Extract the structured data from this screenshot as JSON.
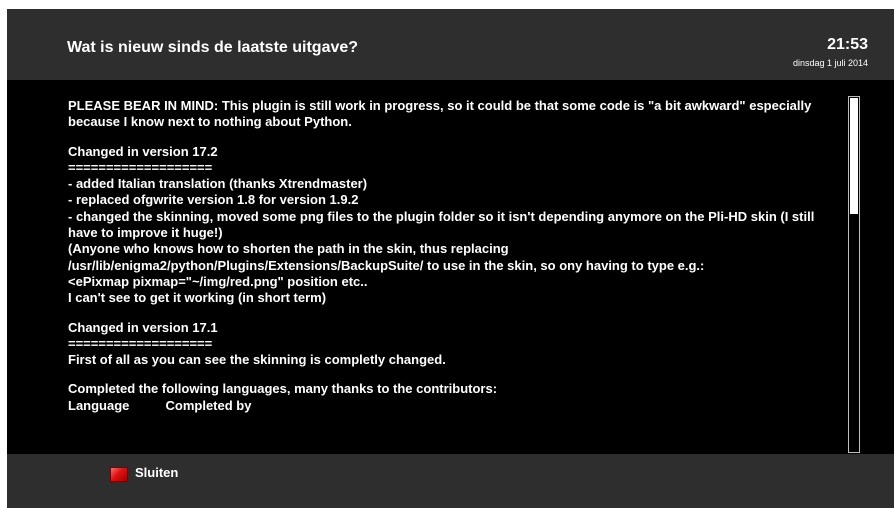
{
  "header": {
    "title": "Wat is nieuw sinds de laatste uitgave?",
    "time": "21:53",
    "date": "dinsdag  1 juli 2014"
  },
  "content": {
    "notice": "PLEASE BEAR IN MIND: This plugin is still work in progress, so it could be that some code is \"a bit awkward\" especially because I know next to nothing about Python.",
    "v172_heading": "Changed in version 17.2",
    "v172_rule": "===================",
    "v172_line1": "- added Italian translation (thanks Xtrendmaster)",
    "v172_line2": "- replaced ofgwrite version 1.8 for version 1.9.2",
    "v172_line3": "- changed the skinning, moved some png files to the plugin folder so it isn't depending anymore on the Pli-HD skin (I still have to improve it huge!)",
    "v172_line4": "(Anyone who knows how to shorten the path in the skin, thus replacing",
    "v172_line5": "/usr/lib/enigma2/python/Plugins/Extensions/BackupSuite/ to use in the skin, so ony having to type e.g.:",
    "v172_line6": "<ePixmap pixmap=\"~/img/red.png\" position etc..",
    "v172_line7": "I can't see to get it working (in short term)",
    "v171_heading": "Changed in version 17.1",
    "v171_rule": "===================",
    "v171_line1": "First of all as you can see the skinning is completly changed.",
    "completed_line": "Completed the following languages, many thanks to the contributors:",
    "table_header": "Language          Completed by"
  },
  "footer": {
    "red_button_label": "Sluiten"
  },
  "colors": {
    "header_bg": "#2e2e2e",
    "body_bg": "#000000",
    "red_key": "#e01010"
  }
}
